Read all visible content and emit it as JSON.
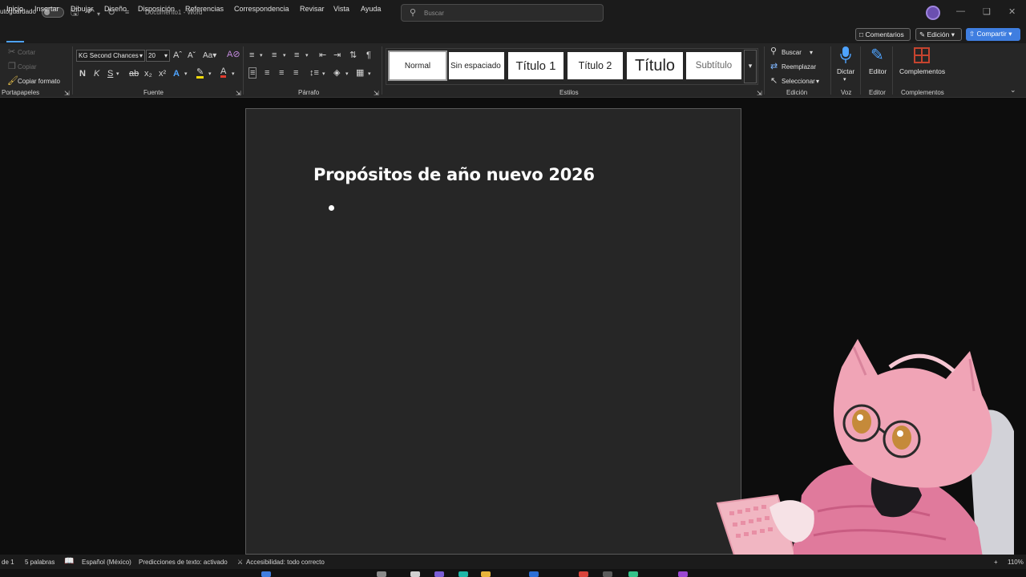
{
  "titlebar": {
    "autosave_label": "utoguardado",
    "doc_title": "Documento1 - Word",
    "search_placeholder": "Buscar",
    "quick_icons": [
      "save-icon",
      "undo-icon",
      "redo-icon",
      "customize-icon"
    ],
    "window_buttons": [
      "minimize-icon",
      "restore-icon",
      "close-icon"
    ]
  },
  "tabs": [
    "Inicio",
    "Insertar",
    "Dibujar",
    "Diseño",
    "Disposición",
    "Referencias",
    "Correspondencia",
    "Revisar",
    "Vista",
    "Ayuda"
  ],
  "active_tab": "Inicio",
  "right_actions": {
    "comments": "Comentarios",
    "editing": "Edición",
    "share": "Compartir"
  },
  "ribbon": {
    "clipboard": {
      "cut": "Cortar",
      "copy": "Copiar",
      "format_painter": "Copiar formato",
      "label": "Portapapeles"
    },
    "font": {
      "family": "KG Second Chances",
      "size": "20",
      "bold": "N",
      "italic": "K",
      "sub": "x₂",
      "sup": "x²",
      "label": "Fuente"
    },
    "paragraph": {
      "label": "Párrafo"
    },
    "styles": {
      "items": [
        "Normal",
        "Sin espaciado",
        "Título 1",
        "Título 2",
        "Título",
        "Subtítulo"
      ],
      "label": "Estilos"
    },
    "editing": {
      "find": "Buscar",
      "replace": "Reemplazar",
      "select": "Seleccionar",
      "label": "Edición"
    },
    "voice": {
      "dictate": "Dictar",
      "label": "Voz"
    },
    "editor": {
      "button": "Editor",
      "label": "Editor"
    },
    "addins": {
      "button": "Complementos",
      "label": "Complementos"
    }
  },
  "document": {
    "heading": "Propósitos de año nuevo 2026"
  },
  "statusbar": {
    "page": "de 1",
    "words": "5 palabras",
    "language": "Español (México)",
    "predictions": "Predicciones de texto: activado",
    "accessibility": "Accesibilidad: todo correcto",
    "zoom": "110%"
  },
  "colors": {
    "accent_blue": "#3f7ee0",
    "highlight_yellow": "#f2d90a",
    "font_red": "#e23b2e",
    "page_bg": "#262626",
    "app_bg": "#0d0d0d"
  }
}
